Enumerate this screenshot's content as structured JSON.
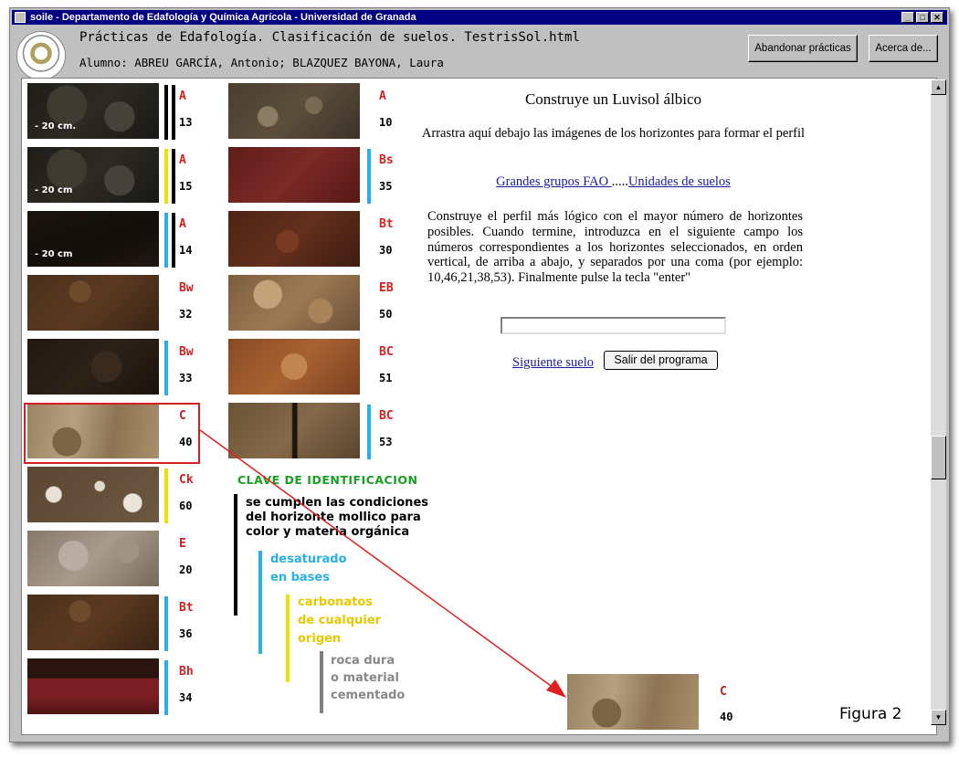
{
  "window": {
    "title": "soile - Departamento de Edafología y Química Agrícola - Universidad de Granada"
  },
  "header": {
    "page_title": "Prácticas de Edafología. Clasificación de suelos. TestrisSol.html",
    "student": "Alumno: ABREU GARCÍA, Antonio; BLAZQUEZ BAYONA, Laura",
    "quit_practice_button": "Abandonar prácticas",
    "about_button": "Acerca de..."
  },
  "horizons_left": [
    {
      "name": "A",
      "number": "13",
      "depth": "- 20 cm.",
      "bar": "#000000",
      "photo": "dark-soil"
    },
    {
      "name": "A",
      "number": "15",
      "depth": "- 20 cm",
      "bar": "#f0e000",
      "photo": "dark-soil"
    },
    {
      "name": "A",
      "number": "14",
      "depth": "- 20 cm",
      "bar": "#2ab0e8",
      "photo": "black-soil"
    },
    {
      "name": "Bw",
      "number": "32",
      "depth": "",
      "bar": "",
      "photo": "brown-soil"
    },
    {
      "name": "Bw",
      "number": "33",
      "depth": "",
      "bar": "#2ab0e8",
      "photo": "dark-brown-soil"
    },
    {
      "name": "C",
      "number": "40",
      "depth": "",
      "bar": "",
      "photo": "tan-soil"
    },
    {
      "name": "Ck",
      "number": "60",
      "depth": "",
      "bar": "#f0e000",
      "photo": "white-spotted-soil"
    },
    {
      "name": "E",
      "number": "20",
      "depth": "",
      "bar": "",
      "photo": "grey-soil"
    },
    {
      "name": "Bt",
      "number": "36",
      "depth": "",
      "bar": "#2ab0e8",
      "photo": "brown-soil"
    },
    {
      "name": "Bh",
      "number": "34",
      "depth": "",
      "bar": "#2ab0e8",
      "photo": "red-dark-soil"
    }
  ],
  "horizons_right": [
    {
      "name": "A",
      "number": "10",
      "bar": "",
      "photo": "rocky-soil"
    },
    {
      "name": "Bs",
      "number": "35",
      "bar": "#2ab0e8",
      "photo": "red-soil"
    },
    {
      "name": "Bt",
      "number": "30",
      "bar": "",
      "photo": "red-brown-soil"
    },
    {
      "name": "EB",
      "number": "50",
      "bar": "",
      "photo": "mixed-soil"
    },
    {
      "name": "BC",
      "number": "51",
      "bar": "",
      "photo": "orange-soil"
    },
    {
      "name": "BC",
      "number": "53",
      "bar": "#2ab0e8",
      "photo": "cracked-soil"
    }
  ],
  "key": {
    "title": "CLAVE DE IDENTIFICACION",
    "mollic": [
      "se cumplen las condiciones",
      "del horizonte mollico para",
      "color y materia orgánica"
    ],
    "desaturated": [
      "desaturado",
      "en bases"
    ],
    "carbonates": [
      "carbonatos",
      "de cualquier",
      "origen"
    ],
    "hard_rock": [
      "roca dura",
      "o material",
      "cementado"
    ]
  },
  "task": {
    "heading": "Construye un Luvisol álbico",
    "instruction": "Arrastra aquí debajo las imágenes de los horizontes para formar el perfil",
    "fao_link": "Grandes grupos FAO ",
    "dots": ".....",
    "units_link": "Unidades de suelos",
    "body": "Construye el perfil más lógico con el mayor número de horizontes posibles. Cuando termine, introduzca en el siguiente campo los números correspondientes a los horizontes seleccionados, en orden vertical, de arriba a abajo, y separados por una coma (por ejemplo: 10,46,21,38,53). Finalmente pulse la tecla \"enter\"",
    "answer_value": "",
    "next_soil_link": "Siguiente suelo ",
    "exit_button": "Salir del programa"
  },
  "dropped": {
    "name": "C",
    "number": "40",
    "photo": "tan-soil"
  },
  "figure_caption": "Figura 2",
  "colors": {
    "titlebar": "#000080",
    "horizon_name": "#d42020",
    "key_title": "#18a020",
    "blue_bar": "#2ab0e8",
    "yellow_bar": "#f0e000",
    "highlight": "#d42020",
    "link": "#1a1aa0"
  }
}
